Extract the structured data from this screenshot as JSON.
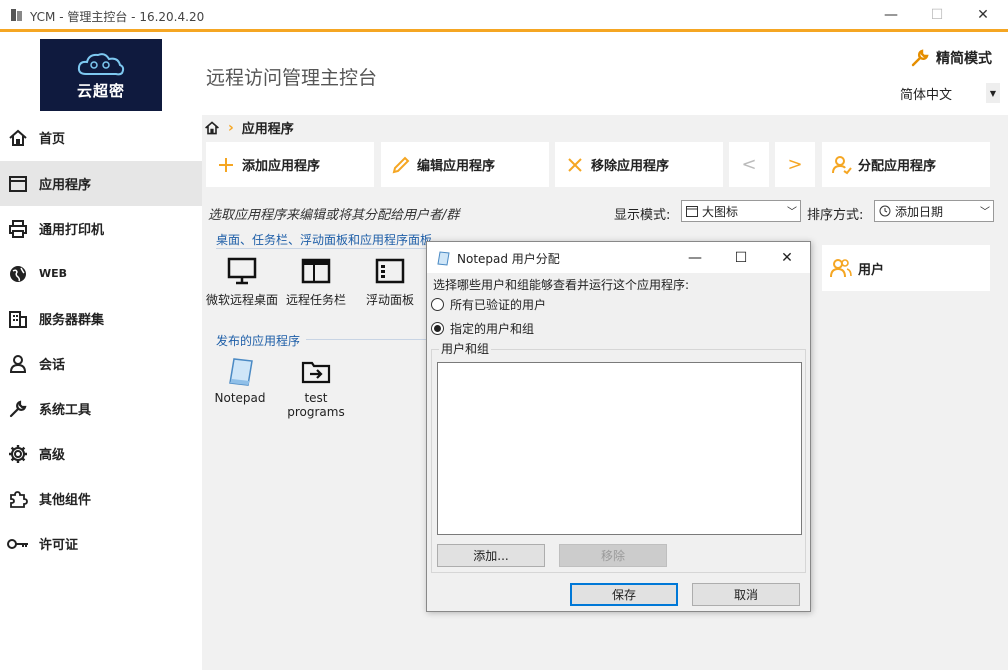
{
  "window": {
    "title": "YCM - 管理主控台 - 16.20.4.20",
    "min_symbol": "—",
    "max_symbol": "☐",
    "close_symbol": "✕"
  },
  "header": {
    "logo_text": "云超密",
    "console_title": "远程访问管理主控台",
    "simple_mode_label": "精简模式",
    "language_value": "简体中文"
  },
  "sidebar": {
    "items": [
      {
        "label": "首页",
        "icon": "home-icon"
      },
      {
        "label": "应用程序",
        "icon": "window-icon",
        "active": true
      },
      {
        "label": "通用打印机",
        "icon": "printer-icon"
      },
      {
        "label": "WEB",
        "icon": "globe-icon"
      },
      {
        "label": "服务器群集",
        "icon": "building-icon"
      },
      {
        "label": "会话",
        "icon": "user-icon"
      },
      {
        "label": "系统工具",
        "icon": "wrench-icon"
      },
      {
        "label": "高级",
        "icon": "gear-icon"
      },
      {
        "label": "其他组件",
        "icon": "puzzle-icon"
      },
      {
        "label": "许可证",
        "icon": "key-icon"
      }
    ]
  },
  "breadcrumb": {
    "current": "应用程序"
  },
  "toolbar": {
    "add_label": "添加应用程序",
    "edit_label": "编辑应用程序",
    "remove_label": "移除应用程序",
    "prev_symbol": "<",
    "next_symbol": ">",
    "assign_label": "分配应用程序"
  },
  "content": {
    "hint": "选取应用程序来编辑或将其分配给用户者/群",
    "display_mode_label": "显示模式:",
    "display_mode_value": "大图标",
    "sort_label": "排序方式:",
    "sort_value": "添加日期",
    "section_desktop": "桌面、任务栏、浮动面板和应用程序面板",
    "desktop_tiles": [
      {
        "label": "微软远程桌面",
        "icon": "monitor-icon"
      },
      {
        "label": "远程任务栏",
        "icon": "taskbar-icon"
      },
      {
        "label": "浮动面板",
        "icon": "panel-icon"
      }
    ],
    "section_published": "发布的应用程序",
    "published_tiles": [
      {
        "label": "Notepad",
        "icon": "notepad-icon"
      },
      {
        "label": "test programs",
        "icon": "folder-arrow-icon"
      }
    ],
    "users_label": "用户"
  },
  "dialog": {
    "title": "Notepad 用户分配",
    "prompt": "选择哪些用户和组能够查看并运行这个应用程序:",
    "option_all": "所有已验证的用户",
    "option_specific": "指定的用户和组",
    "selected_option": "specific",
    "group_label": "用户和组",
    "add_button": "添加...",
    "remove_button": "移除",
    "save_button": "保存",
    "cancel_button": "取消"
  },
  "colors": {
    "accent": "#f5a623",
    "logo_bg": "#0f1a3e",
    "section_title": "#1f5fa8"
  }
}
